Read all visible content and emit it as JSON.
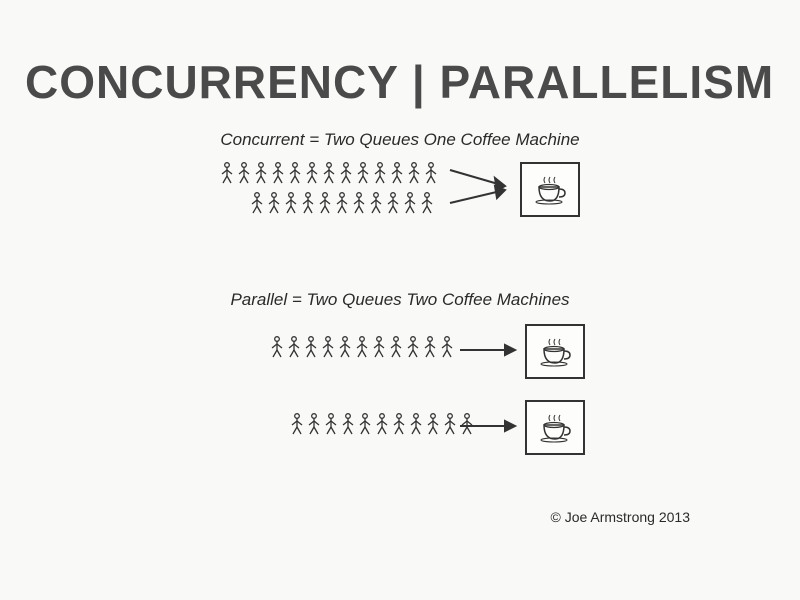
{
  "title": "CONCURRENCY | PARALLELISM",
  "concurrent": {
    "caption": "Concurrent = Two Queues One Coffee Machine",
    "queue1_count": 13,
    "queue2_count": 11,
    "machines": 1
  },
  "parallel": {
    "caption": "Parallel = Two Queues Two Coffee Machines",
    "queue1_count": 11,
    "queue2_count": 11,
    "machines": 2
  },
  "attribution": "© Joe Armstrong 2013"
}
